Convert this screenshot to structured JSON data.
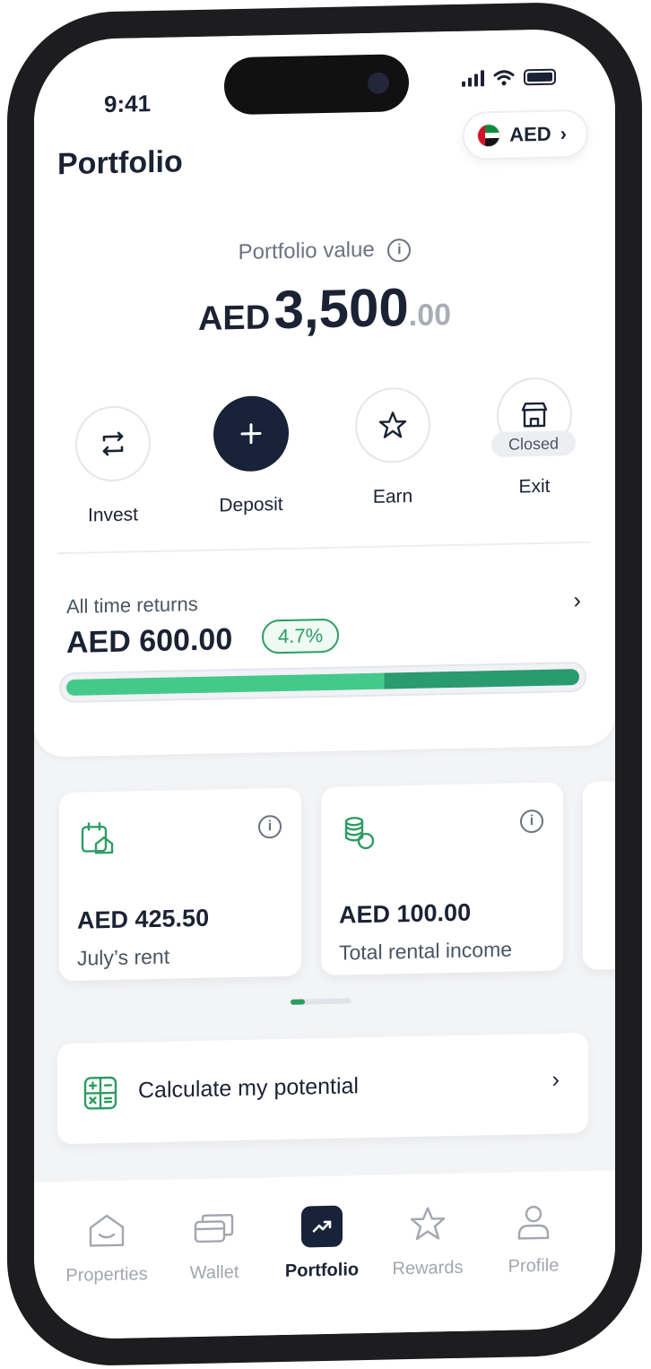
{
  "status_bar": {
    "time": "9:41"
  },
  "header": {
    "title": "Portfolio",
    "currency": "AED",
    "currency_chevron": "›"
  },
  "portfolio": {
    "label": "Portfolio value",
    "currency": "AED",
    "amount": "3,500",
    "decimals": ".00"
  },
  "actions": [
    {
      "label": "Invest",
      "icon": "swap-icon"
    },
    {
      "label": "Deposit",
      "icon": "plus-icon"
    },
    {
      "label": "Earn",
      "icon": "star-icon"
    },
    {
      "label": "Exit",
      "icon": "store-icon",
      "badge": "Closed"
    }
  ],
  "returns": {
    "label": "All time returns",
    "amount": "AED 600.00",
    "percent": "4.7%",
    "chevron": "›",
    "progress_fraction": 0.62
  },
  "cards": [
    {
      "amount": "AED 425.50",
      "caption": "July’s rent",
      "icon": "calendar-home-icon"
    },
    {
      "amount": "AED 100.00",
      "caption": "Total rental income",
      "icon": "coins-icon"
    }
  ],
  "calculator": {
    "label": "Calculate my potential",
    "chevron": "›",
    "icon": "calculator-icon"
  },
  "tabs": [
    {
      "label": "Properties",
      "icon": "home-icon",
      "active": false
    },
    {
      "label": "Wallet",
      "icon": "wallet-icon",
      "active": false
    },
    {
      "label": "Portfolio",
      "icon": "trend-icon",
      "active": true
    },
    {
      "label": "Rewards",
      "icon": "star-icon",
      "active": false
    },
    {
      "label": "Profile",
      "icon": "user-icon",
      "active": false
    }
  ],
  "colors": {
    "navy": "#182238",
    "green": "#2e9c64",
    "green_light": "#45c98b",
    "green_dark": "#2a9a6f",
    "muted": "#a2a6af"
  }
}
